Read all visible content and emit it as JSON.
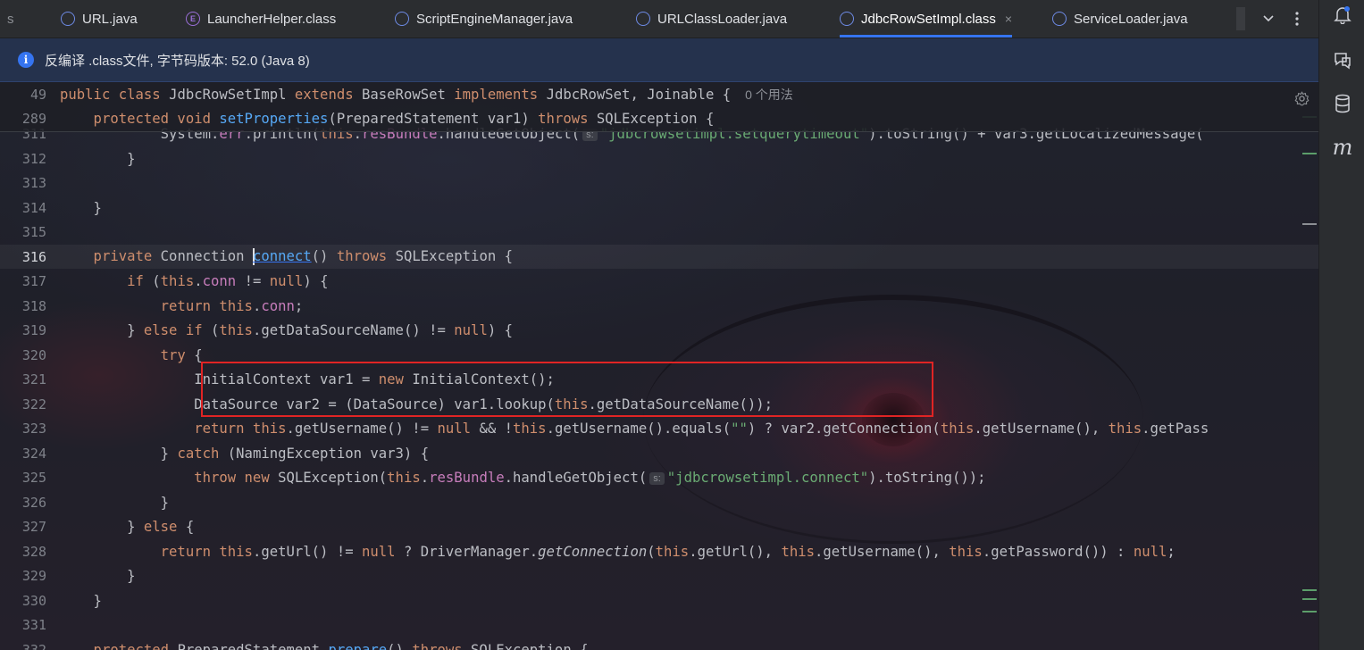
{
  "tabs": [
    {
      "label": "s",
      "icon": "none",
      "active": false
    },
    {
      "label": "URL.java",
      "icon": "class-icon",
      "active": false
    },
    {
      "label": "LauncherHelper.class",
      "icon": "enum-icon",
      "active": false
    },
    {
      "label": "ScriptEngineManager.java",
      "icon": "class-icon",
      "active": false
    },
    {
      "label": "URLClassLoader.java",
      "icon": "class-icon",
      "active": false
    },
    {
      "label": "JdbcRowSetImpl.class",
      "icon": "class-icon",
      "active": true
    },
    {
      "label": "ServiceLoader.java",
      "icon": "class-icon",
      "active": false
    }
  ],
  "tab_close_glyph": "×",
  "banner": {
    "text": "反编译 .class文件, 字节码版本: 52.0 (Java 8)"
  },
  "sticky_lines": [
    {
      "num": "49",
      "tokens": [
        {
          "t": "public class ",
          "c": "kw"
        },
        {
          "t": "JdbcRowSetImpl ",
          "c": "pl"
        },
        {
          "t": "extends ",
          "c": "kw"
        },
        {
          "t": "BaseRowSet ",
          "c": "pl"
        },
        {
          "t": "implements ",
          "c": "kw"
        },
        {
          "t": "JdbcRowSet, Joinable {",
          "c": "pl"
        }
      ],
      "usage": "0 个用法"
    },
    {
      "num": "289",
      "tokens": [
        {
          "t": "    protected void ",
          "c": "kw"
        },
        {
          "t": "setProperties",
          "c": "fn"
        },
        {
          "t": "(PreparedStatement var1) ",
          "c": "pl"
        },
        {
          "t": "throws ",
          "c": "kw"
        },
        {
          "t": "SQLException {",
          "c": "pl"
        }
      ]
    }
  ],
  "lines": [
    {
      "num": "311",
      "tokens": [
        {
          "t": "            System.",
          "c": "pl"
        },
        {
          "t": "err",
          "c": "fd"
        },
        {
          "t": ".println(",
          "c": "pl"
        },
        {
          "t": "this",
          "c": "kw"
        },
        {
          "t": ".",
          "c": "pl"
        },
        {
          "t": "resBundle",
          "c": "fd"
        },
        {
          "t": ".handleGetObject(",
          "c": "pl"
        },
        {
          "hint": "s:"
        },
        {
          "t": "\"jdbcrowsetimpl.setquerytimeout\"",
          "c": "st"
        },
        {
          "t": ").toString() + var3.getLocalizedMessage(",
          "c": "pl"
        }
      ]
    },
    {
      "num": "312",
      "tokens": [
        {
          "t": "        }",
          "c": "pl"
        }
      ]
    },
    {
      "num": "313",
      "tokens": []
    },
    {
      "num": "314",
      "tokens": [
        {
          "t": "    }",
          "c": "pl"
        }
      ]
    },
    {
      "num": "315",
      "tokens": []
    },
    {
      "num": "316",
      "current": true,
      "tokens": [
        {
          "t": "    private ",
          "c": "kw"
        },
        {
          "t": "Connection ",
          "c": "pl"
        },
        {
          "caret": true
        },
        {
          "t": "connect",
          "c": "ul"
        },
        {
          "t": "() ",
          "c": "pl"
        },
        {
          "t": "throws ",
          "c": "kw"
        },
        {
          "t": "SQLException {",
          "c": "pl"
        }
      ]
    },
    {
      "num": "317",
      "tokens": [
        {
          "t": "        if ",
          "c": "kw"
        },
        {
          "t": "(",
          "c": "pl"
        },
        {
          "t": "this",
          "c": "kw"
        },
        {
          "t": ".",
          "c": "pl"
        },
        {
          "t": "conn",
          "c": "fd"
        },
        {
          "t": " != ",
          "c": "pl"
        },
        {
          "t": "null",
          "c": "kw"
        },
        {
          "t": ") {",
          "c": "pl"
        }
      ]
    },
    {
      "num": "318",
      "tokens": [
        {
          "t": "            return this",
          "c": "kw"
        },
        {
          "t": ".",
          "c": "pl"
        },
        {
          "t": "conn",
          "c": "fd"
        },
        {
          "t": ";",
          "c": "pl"
        }
      ]
    },
    {
      "num": "319",
      "tokens": [
        {
          "t": "        } ",
          "c": "pl"
        },
        {
          "t": "else if ",
          "c": "kw"
        },
        {
          "t": "(",
          "c": "pl"
        },
        {
          "t": "this",
          "c": "kw"
        },
        {
          "t": ".getDataSourceName() != ",
          "c": "pl"
        },
        {
          "t": "null",
          "c": "kw"
        },
        {
          "t": ") {",
          "c": "pl"
        }
      ]
    },
    {
      "num": "320",
      "tokens": [
        {
          "t": "            try ",
          "c": "kw"
        },
        {
          "t": "{",
          "c": "pl"
        }
      ]
    },
    {
      "num": "321",
      "tokens": [
        {
          "t": "                InitialContext var1 = ",
          "c": "pl"
        },
        {
          "t": "new ",
          "c": "kw"
        },
        {
          "t": "InitialContext();",
          "c": "pl"
        }
      ]
    },
    {
      "num": "322",
      "tokens": [
        {
          "t": "                DataSource var2 = (DataSource) var1.lookup(",
          "c": "pl"
        },
        {
          "t": "this",
          "c": "kw"
        },
        {
          "t": ".getDataSourceName());",
          "c": "pl"
        }
      ]
    },
    {
      "num": "323",
      "tokens": [
        {
          "t": "                return this",
          "c": "kw"
        },
        {
          "t": ".getUsername() != ",
          "c": "pl"
        },
        {
          "t": "null ",
          "c": "kw"
        },
        {
          "t": "&& !",
          "c": "pl"
        },
        {
          "t": "this",
          "c": "kw"
        },
        {
          "t": ".getUsername().equals(",
          "c": "pl"
        },
        {
          "t": "\"\"",
          "c": "st"
        },
        {
          "t": ") ? var2.getConnection(",
          "c": "pl"
        },
        {
          "t": "this",
          "c": "kw"
        },
        {
          "t": ".getUsername(), ",
          "c": "pl"
        },
        {
          "t": "this",
          "c": "kw"
        },
        {
          "t": ".getPass",
          "c": "pl"
        }
      ]
    },
    {
      "num": "324",
      "tokens": [
        {
          "t": "            } ",
          "c": "pl"
        },
        {
          "t": "catch ",
          "c": "kw"
        },
        {
          "t": "(NamingException var3) {",
          "c": "pl"
        }
      ]
    },
    {
      "num": "325",
      "tokens": [
        {
          "t": "                throw new ",
          "c": "kw"
        },
        {
          "t": "SQLException(",
          "c": "pl"
        },
        {
          "t": "this",
          "c": "kw"
        },
        {
          "t": ".",
          "c": "pl"
        },
        {
          "t": "resBundle",
          "c": "fd"
        },
        {
          "t": ".handleGetObject(",
          "c": "pl"
        },
        {
          "hint": "s:"
        },
        {
          "t": "\"jdbcrowsetimpl.",
          "c": "st"
        },
        {
          "t": "connect",
          "c": "st"
        },
        {
          "t": "\"",
          "c": "st"
        },
        {
          "t": ").toString());",
          "c": "pl"
        }
      ]
    },
    {
      "num": "326",
      "tokens": [
        {
          "t": "            }",
          "c": "pl"
        }
      ]
    },
    {
      "num": "327",
      "tokens": [
        {
          "t": "        } ",
          "c": "pl"
        },
        {
          "t": "else ",
          "c": "kw"
        },
        {
          "t": "{",
          "c": "pl"
        }
      ]
    },
    {
      "num": "328",
      "tokens": [
        {
          "t": "            return this",
          "c": "kw"
        },
        {
          "t": ".getUrl() != ",
          "c": "pl"
        },
        {
          "t": "null ",
          "c": "kw"
        },
        {
          "t": "? DriverManager.",
          "c": "pl"
        },
        {
          "t": "getConnection",
          "c": "it"
        },
        {
          "t": "(",
          "c": "pl"
        },
        {
          "t": "this",
          "c": "kw"
        },
        {
          "t": ".getUrl(), ",
          "c": "pl"
        },
        {
          "t": "this",
          "c": "kw"
        },
        {
          "t": ".getUsername(), ",
          "c": "pl"
        },
        {
          "t": "this",
          "c": "kw"
        },
        {
          "t": ".getPassword()) : ",
          "c": "pl"
        },
        {
          "t": "null",
          "c": "kw"
        },
        {
          "t": ";",
          "c": "pl"
        }
      ]
    },
    {
      "num": "329",
      "tokens": [
        {
          "t": "        }",
          "c": "pl"
        }
      ]
    },
    {
      "num": "330",
      "tokens": [
        {
          "t": "    }",
          "c": "pl"
        }
      ]
    },
    {
      "num": "331",
      "tokens": []
    },
    {
      "num": "332",
      "tokens": [
        {
          "t": "    protected ",
          "c": "kw"
        },
        {
          "t": "PreparedStatement ",
          "c": "pl"
        },
        {
          "t": "prepare",
          "c": "fn"
        },
        {
          "t": "() ",
          "c": "pl"
        },
        {
          "t": "throws ",
          "c": "kw"
        },
        {
          "t": "SQLException {",
          "c": "pl"
        }
      ]
    }
  ],
  "right_tools": [
    {
      "name": "notifications-icon"
    },
    {
      "name": "ai-chat-icon"
    },
    {
      "name": "database-icon"
    },
    {
      "name": "maven-icon",
      "glyph": "m"
    }
  ],
  "colors": {
    "keyword": "#cf8e6d",
    "function": "#56a8f5",
    "string": "#6aab73",
    "field": "#c77dbb",
    "highlight_box": "#e02424",
    "accent": "#3574f0"
  }
}
